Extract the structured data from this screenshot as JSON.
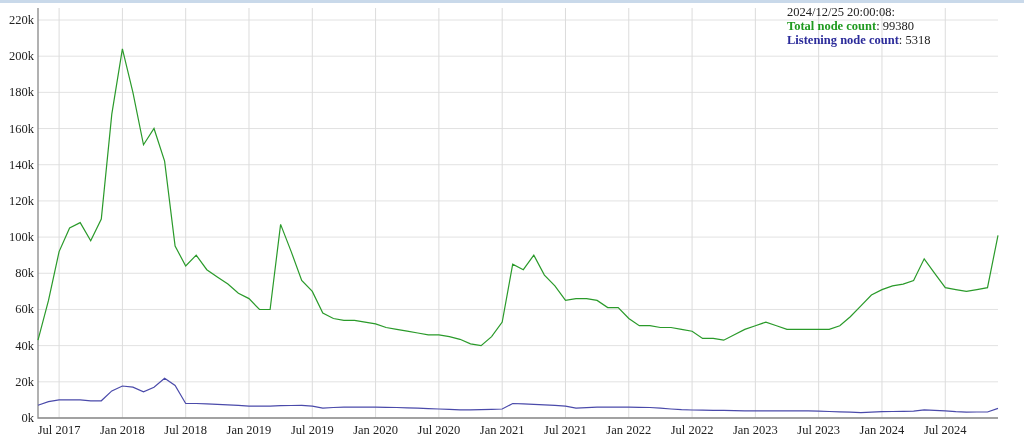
{
  "legend": {
    "timestamp": "2024/12/25 20:00:08:",
    "delimiter": ":",
    "lines": [
      {
        "value": "99380",
        "color": "#1f9a1f"
      },
      {
        "value": "5318",
        "color": "#2b2b9a"
      }
    ]
  },
  "chart": {
    "chart_data": {
      "type": "line",
      "grid": true,
      "ylim": [
        0,
        220
      ],
      "categories": [
        null,
        null,
        "Jul 2017",
        null,
        null,
        null,
        null,
        null,
        "Jan 2018",
        null,
        null,
        null,
        null,
        null,
        "Jul 2018",
        null,
        null,
        null,
        null,
        null,
        "Jan 2019",
        null,
        null,
        null,
        null,
        null,
        "Jul 2019",
        null,
        null,
        null,
        null,
        null,
        "Jan 2020",
        null,
        null,
        null,
        null,
        null,
        "Jul 2020",
        null,
        null,
        null,
        null,
        null,
        "Jan 2021",
        null,
        null,
        null,
        null,
        null,
        "Jul 2021",
        null,
        null,
        null,
        null,
        null,
        "Jan 2022",
        null,
        null,
        null,
        null,
        null,
        "Jul 2022",
        null,
        null,
        null,
        null,
        null,
        "Jan 2023",
        null,
        null,
        null,
        null,
        null,
        "Jul 2023",
        null,
        null,
        null,
        null,
        null,
        "Jan 2024",
        null,
        null,
        null,
        null,
        null,
        "Jul 2024",
        null,
        null,
        null,
        null,
        null
      ],
      "series": [
        {
          "name": "Total node count",
          "color": "#2a9a2a",
          "values": [
            43,
            65,
            92,
            105,
            108,
            98,
            110,
            168,
            204,
            180,
            151,
            160,
            142,
            95,
            84,
            90,
            82,
            78,
            74,
            69,
            66,
            60,
            60,
            107,
            92,
            76,
            70,
            58,
            55,
            54,
            54,
            53,
            52,
            50,
            49,
            48,
            47,
            46,
            46,
            45,
            43.5,
            41,
            40,
            45,
            53,
            85,
            82,
            90,
            79,
            73,
            65,
            66,
            66,
            65,
            61,
            61,
            55,
            51,
            51,
            50,
            50,
            49,
            48,
            44,
            44,
            43,
            46,
            49,
            51,
            53,
            51,
            49,
            49,
            49,
            49,
            49,
            51,
            56,
            62,
            68,
            71,
            73,
            74,
            76,
            88,
            80,
            72,
            71,
            70,
            71,
            72,
            101
          ]
        },
        {
          "name": "Listening node count",
          "color": "#4a4aaa",
          "values": [
            7,
            9,
            10,
            10,
            10,
            9.5,
            9.5,
            15,
            17.7,
            17,
            14.5,
            17,
            22,
            18,
            8,
            8,
            7.8,
            7.5,
            7.3,
            7,
            6.6,
            6.6,
            6.5,
            6.8,
            6.9,
            7,
            6.5,
            5.5,
            5.8,
            6,
            6,
            6,
            6,
            5.9,
            5.8,
            5.6,
            5.4,
            5.2,
            5,
            4.8,
            4.5,
            4.5,
            4.6,
            4.8,
            5,
            8,
            7.8,
            7.5,
            7.3,
            7,
            6.5,
            5.5,
            5.7,
            6,
            6,
            6,
            6,
            5.9,
            5.8,
            5.5,
            5,
            4.6,
            4.4,
            4.3,
            4.2,
            4.2,
            4.1,
            4,
            4,
            4,
            4,
            4,
            4,
            3.9,
            3.8,
            3.6,
            3.4,
            3.2,
            3,
            3.2,
            3.5,
            3.6,
            3.7,
            3.8,
            4.5,
            4.2,
            4,
            3.5,
            3.2,
            3.3,
            3.3,
            5.3
          ]
        }
      ],
      "yticks": [
        {
          "value": 0,
          "label": "0k"
        },
        {
          "value": 20,
          "label": "20k"
        },
        {
          "value": 40,
          "label": "40k"
        },
        {
          "value": 60,
          "label": "60k"
        },
        {
          "value": 80,
          "label": "80k"
        },
        {
          "value": 100,
          "label": "100k"
        },
        {
          "value": 120,
          "label": "120k"
        },
        {
          "value": 140,
          "label": "140k"
        },
        {
          "value": 160,
          "label": "160k"
        },
        {
          "value": 180,
          "label": "180k"
        },
        {
          "value": 200,
          "label": "200k"
        },
        {
          "value": 220,
          "label": "220k"
        }
      ]
    }
  }
}
